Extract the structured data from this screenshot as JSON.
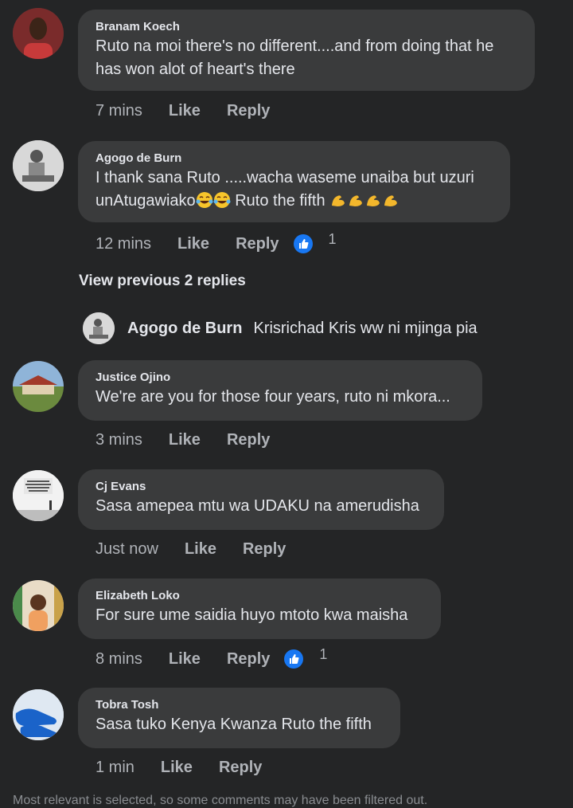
{
  "comments": [
    {
      "author": "Branam Koech",
      "text_lines": [
        "Ruto na moi there's no different....and from doing that he",
        "has won alot of heart's there"
      ],
      "time": "7 mins",
      "like": "Like",
      "reply": "Reply"
    },
    {
      "author": "Agogo de Burn",
      "text_lines": [
        "I thank sana Ruto .....wacha waseme unaiba but uzuri",
        "unAtugawiako",
        " Ruto the fifth "
      ],
      "time": "12 mins",
      "like": "Like",
      "reply": "Reply",
      "reactions": "1"
    },
    {
      "author": "Justice Ojino",
      "text_lines": [
        "We're are you for those four years, ruto ni mkora..."
      ],
      "time": "3 mins",
      "like": "Like",
      "reply": "Reply"
    },
    {
      "author": "Cj Evans",
      "text_lines": [
        "Sasa amepea mtu wa UDAKU na amerudisha"
      ],
      "time": "Just now",
      "like": "Like",
      "reply": "Reply"
    },
    {
      "author": "Elizabeth Loko",
      "text_lines": [
        "For sure ume saidia huyo mtoto kwa maisha"
      ],
      "time": "8 mins",
      "like": "Like",
      "reply": "Reply",
      "reactions": "1"
    },
    {
      "author": "Tobra Tosh",
      "text_lines": [
        "Sasa tuko Kenya Kwanza Ruto the fifth"
      ],
      "time": "1 min",
      "like": "Like",
      "reply": "Reply"
    }
  ],
  "view_previous": "View previous 2 replies",
  "reply_preview": {
    "author": "Agogo de Burn",
    "text": "Krisrichad Kris  ww ni mjinga pia"
  },
  "avatar_text_cj": "Always stand up for what you believe in... Even if it means standing alone.",
  "footer": "Most relevant is selected, so some comments may have been filtered out.",
  "colors": {
    "background": "#242526",
    "bubble": "#3a3b3c",
    "like_blue": "#1877f2",
    "muted": "#b0b3b8"
  },
  "icons": {
    "like_reaction": "thumbs-up-icon",
    "emoji_laugh": "tears-of-joy-emoji",
    "emoji_muscle": "flexed-biceps-emoji"
  }
}
